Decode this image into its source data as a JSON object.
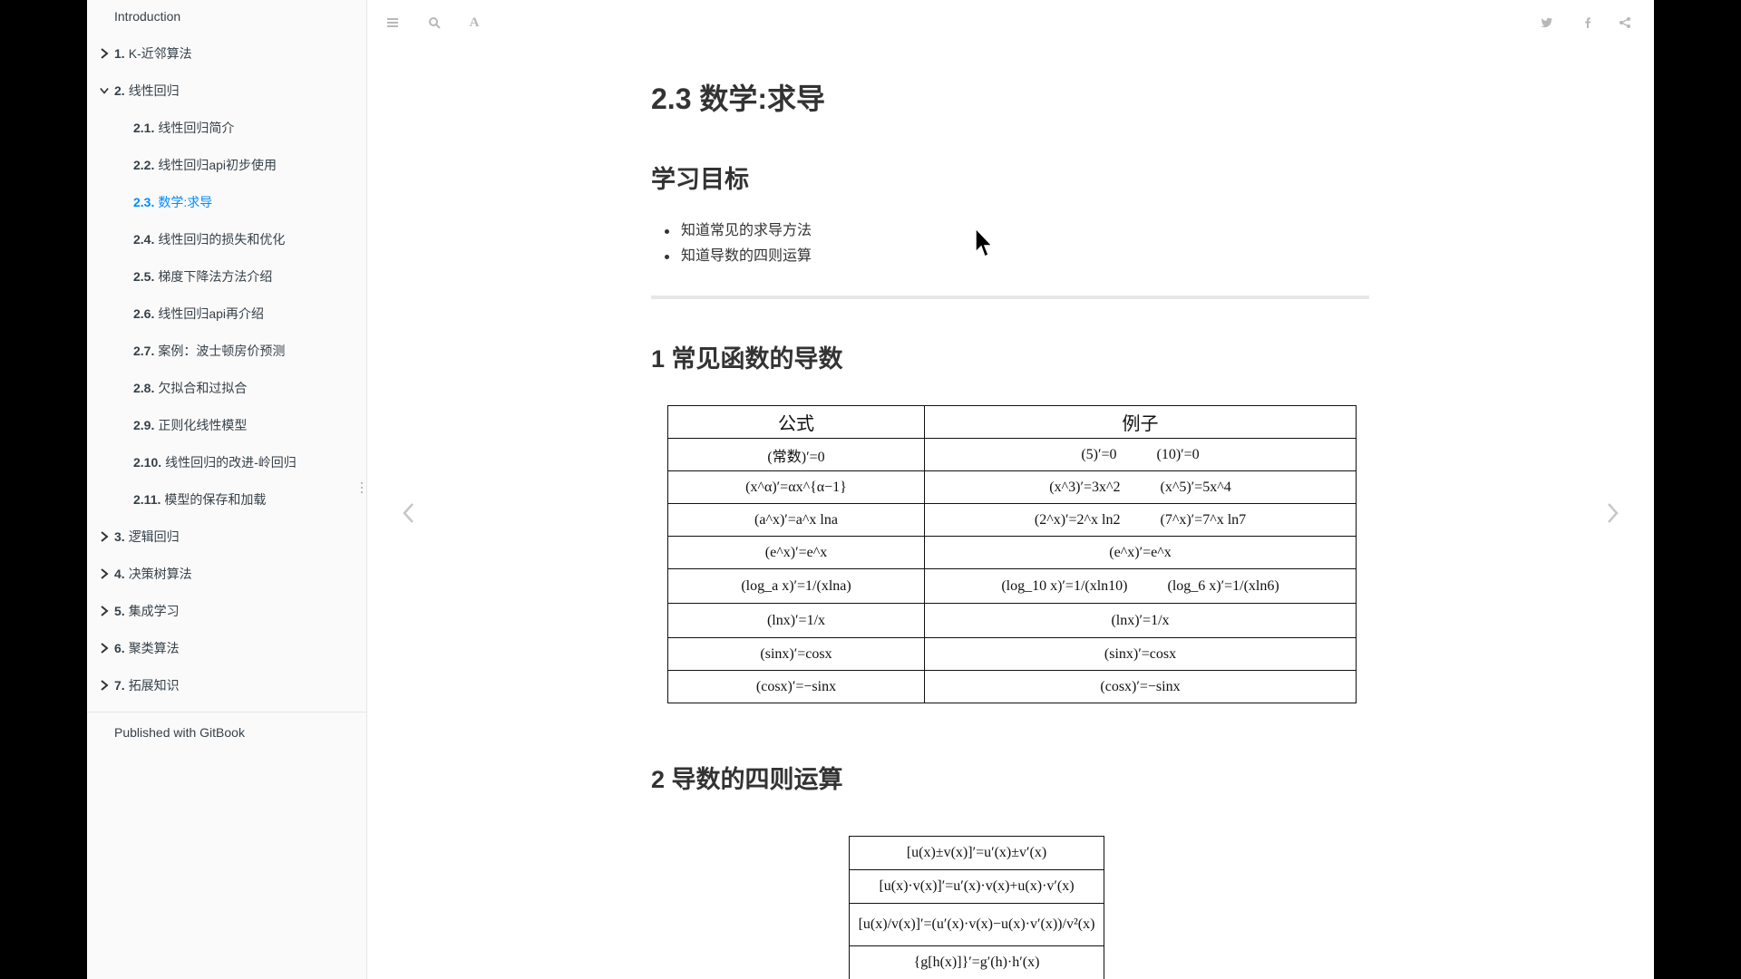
{
  "sidebar": {
    "items": [
      {
        "num": "",
        "label": "Introduction",
        "chevron": "none",
        "level": 0,
        "active": false
      },
      {
        "num": "1.",
        "label": "K-近邻算法",
        "chevron": "right",
        "level": 0,
        "active": false
      },
      {
        "num": "2.",
        "label": "线性回归",
        "chevron": "down",
        "level": 0,
        "active": false
      },
      {
        "num": "2.1.",
        "label": "线性回归简介",
        "chevron": "none",
        "level": 1,
        "active": false
      },
      {
        "num": "2.2.",
        "label": "线性回归api初步使用",
        "chevron": "none",
        "level": 1,
        "active": false
      },
      {
        "num": "2.3.",
        "label": "数学:求导",
        "chevron": "none",
        "level": 1,
        "active": true
      },
      {
        "num": "2.4.",
        "label": "线性回归的损失和优化",
        "chevron": "none",
        "level": 1,
        "active": false
      },
      {
        "num": "2.5.",
        "label": "梯度下降法方法介绍",
        "chevron": "none",
        "level": 1,
        "active": false
      },
      {
        "num": "2.6.",
        "label": "线性回归api再介绍",
        "chevron": "none",
        "level": 1,
        "active": false
      },
      {
        "num": "2.7.",
        "label": "案例：波士顿房价预测",
        "chevron": "none",
        "level": 1,
        "active": false
      },
      {
        "num": "2.8.",
        "label": "欠拟合和过拟合",
        "chevron": "none",
        "level": 1,
        "active": false
      },
      {
        "num": "2.9.",
        "label": "正则化线性模型",
        "chevron": "none",
        "level": 1,
        "active": false
      },
      {
        "num": "2.10.",
        "label": "线性回归的改进-岭回归",
        "chevron": "none",
        "level": 1,
        "active": false
      },
      {
        "num": "2.11.",
        "label": "模型的保存和加载",
        "chevron": "none",
        "level": 1,
        "active": false
      },
      {
        "num": "3.",
        "label": "逻辑回归",
        "chevron": "right",
        "level": 0,
        "active": false
      },
      {
        "num": "4.",
        "label": "决策树算法",
        "chevron": "right",
        "level": 0,
        "active": false
      },
      {
        "num": "5.",
        "label": "集成学习",
        "chevron": "right",
        "level": 0,
        "active": false
      },
      {
        "num": "6.",
        "label": "聚类算法",
        "chevron": "right",
        "level": 0,
        "active": false
      },
      {
        "num": "7.",
        "label": "拓展知识",
        "chevron": "right",
        "level": 0,
        "active": false
      }
    ],
    "footer": "Published with GitBook",
    "active_color": "#008cff"
  },
  "toolbar": {
    "left_icons": [
      "menu-icon",
      "search-icon",
      "font-settings-icon"
    ],
    "right_icons": [
      "twitter-icon",
      "facebook-icon",
      "share-icon"
    ]
  },
  "page": {
    "title": "2.3 数学:求导",
    "goals_heading": "学习目标",
    "goals": [
      "知道常见的求导方法",
      "知道导数的四则运算"
    ],
    "section1_heading": "1 常见函数的导数",
    "section2_heading": "2 导数的四则运算"
  },
  "deriv_table": {
    "headers": [
      "公式",
      "例子"
    ],
    "rows": [
      {
        "formula": "(常数)′=0",
        "examples": [
          "(5)′=0",
          "(10)′=0"
        ]
      },
      {
        "formula": "(x^α)′=αx^{α−1}",
        "examples": [
          "(x^3)′=3x^2",
          "(x^5)′=5x^4"
        ]
      },
      {
        "formula": "(a^x)′=a^x lna",
        "examples": [
          "(2^x)′=2^x ln2",
          "(7^x)′=7^x ln7"
        ]
      },
      {
        "formula": "(e^x)′=e^x",
        "examples": [
          "(e^x)′=e^x"
        ]
      },
      {
        "formula": "(log_a x)′=1/(xlna)",
        "examples": [
          "(log_10 x)′=1/(xln10)",
          "(log_6 x)′=1/(xln6)"
        ]
      },
      {
        "formula": "(lnx)′=1/x",
        "examples": [
          "(lnx)′=1/x"
        ]
      },
      {
        "formula": "(sinx)′=cosx",
        "examples": [
          "(sinx)′=cosx"
        ]
      },
      {
        "formula": "(cosx)′=−sinx",
        "examples": [
          "(cosx)′=−sinx"
        ]
      }
    ]
  },
  "ops_table": [
    "[u(x)±v(x)]′=u′(x)±v′(x)",
    "[u(x)·v(x)]′=u′(x)·v(x)+u(x)·v′(x)",
    "[u(x)/v(x)]′=(u′(x)·v(x)−u(x)·v′(x))/v²(x)",
    "{g[h(x)]}′=g′(h)·h′(x)"
  ],
  "nav": {
    "prev_icon": "chevron-left-icon",
    "next_icon": "chevron-right-icon"
  }
}
